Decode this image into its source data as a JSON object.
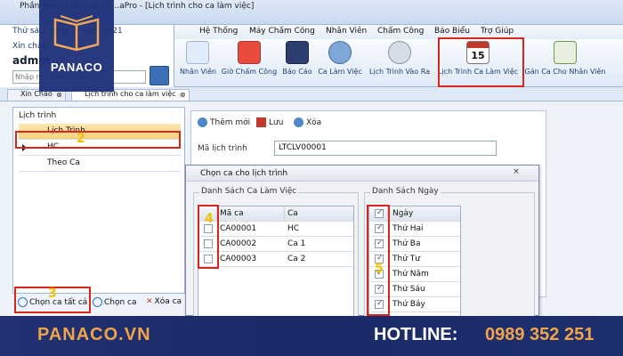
{
  "window": {
    "title": "Phần mềm chấm công ...aPro - [Lịch trình cho ca làm việc]"
  },
  "left_panel": {
    "date": "Thứ sáu, ngày ... năm 2021",
    "greeting": "Xin chào",
    "user": "admin",
    "search_placeholder": "Nhập mã chấm công"
  },
  "menu": {
    "items": [
      "Hệ Thống",
      "Máy Chấm Công",
      "Nhân Viên",
      "Chấm Công",
      "Báo Biểu",
      "Trợ Giúp"
    ]
  },
  "ribbon": {
    "buttons": [
      "Nhân Viên",
      "Giờ Chấm Công",
      "Báo Cáo",
      "Ca Làm Việc",
      "Lịch Trình Vào Ra",
      "Lịch Trình Ca Làm Việc",
      "Gán Ca Cho Nhân Viên"
    ],
    "calendar_day": "15"
  },
  "tabs": [
    {
      "label": "Xin Chào"
    },
    {
      "label": "Lịch trình cho ca làm việc"
    }
  ],
  "schedule_list": {
    "title": "Lịch trình",
    "header": "Lịch Trình",
    "rows": [
      "HC",
      "Theo Ca"
    ]
  },
  "toolbar": {
    "new": "Thêm mới",
    "save": "Lưu",
    "delete": "Xóa"
  },
  "form": {
    "code_label": "Mã lịch trình",
    "code_value": "LTCLV00001"
  },
  "dialog": {
    "title": "Chọn ca cho lịch trình",
    "close": "×",
    "shifts_group": "Danh Sách Ca Làm Việc",
    "shifts_header": {
      "code": "Mã ca",
      "name": "Ca"
    },
    "shifts": [
      {
        "code": "CA00001",
        "name": "HC"
      },
      {
        "code": "CA00002",
        "name": "Ca 1"
      },
      {
        "code": "CA00003",
        "name": "Ca 2"
      }
    ],
    "days_group": "Danh Sách Ngày",
    "days_header": "Ngày",
    "days": [
      "Thứ Hai",
      "Thứ Ba",
      "Thứ Tư",
      "Thứ Năm",
      "Thứ Sáu",
      "Thứ Bảy"
    ]
  },
  "bottom_buttons": {
    "select_all": "Chọn ca tất cả",
    "select": "Chọn ca",
    "delete": "Xóa ca"
  },
  "step_markers": [
    "2",
    "3",
    "4",
    "5"
  ],
  "logo": {
    "text": "PANACO"
  },
  "footer": {
    "website": "PANACO.VN",
    "hotline_label": "HOTLINE:",
    "phone": "0989 352 251"
  },
  "colors": {
    "highlight": "#d9261c",
    "brand_blue": "#213173",
    "brand_orange": "#f0a44a",
    "step_marker": "#f2c200"
  }
}
